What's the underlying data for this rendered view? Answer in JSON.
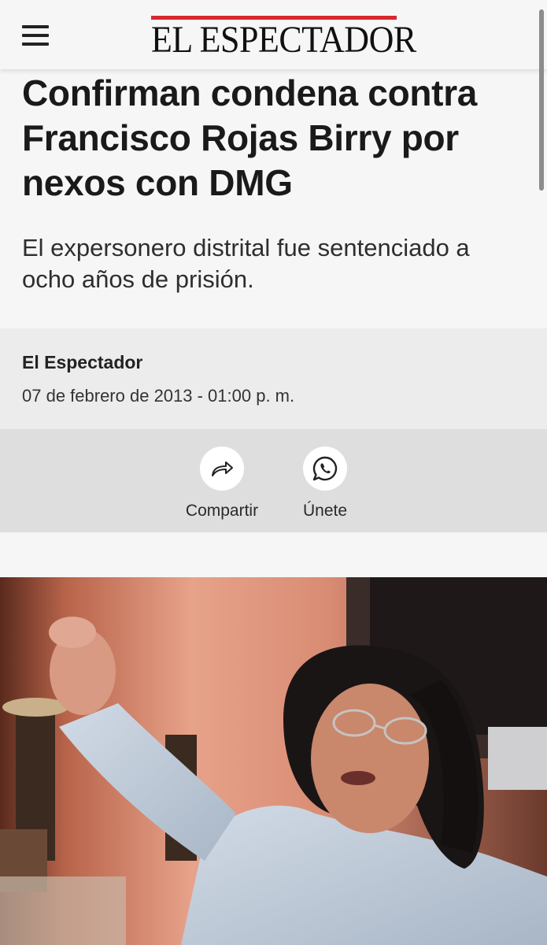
{
  "header": {
    "menu_icon": "hamburger-menu-icon",
    "logo_text": "EL ESPECTADOR",
    "logo_accent": "#d6282d"
  },
  "article": {
    "headline": "Confirman condena contra Francisco Rojas Birry por nexos con DMG",
    "subtitle": "El expersonero distrital fue sentenciado a ocho años de prisión.",
    "author": "El Espectador",
    "date": "07 de febrero de 2013 - 01:00 p. m."
  },
  "actions": {
    "share": {
      "label": "Compartir",
      "icon": "share-arrow-icon"
    },
    "join": {
      "label": "Únete",
      "icon": "whatsapp-icon"
    }
  }
}
